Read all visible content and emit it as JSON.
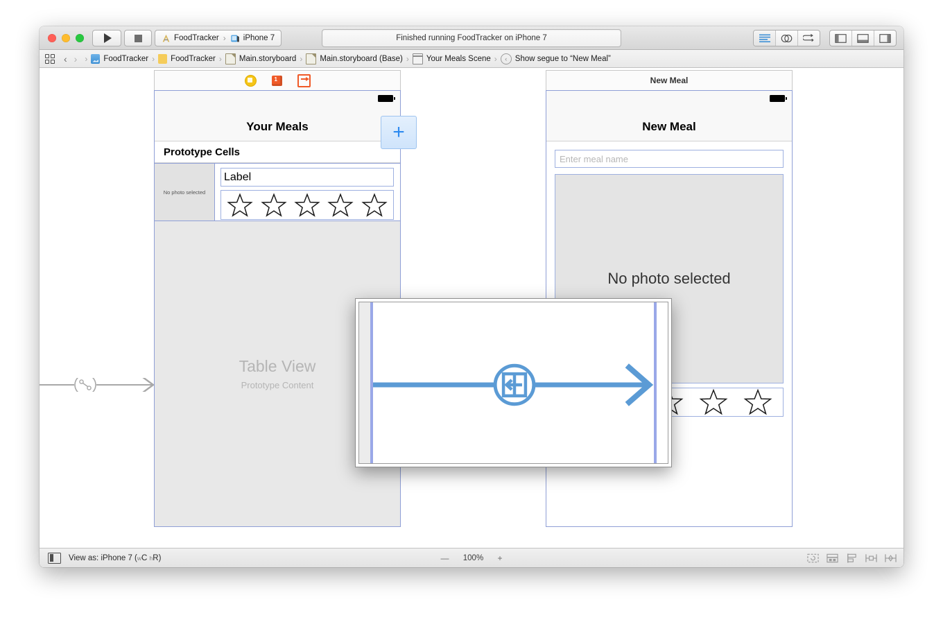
{
  "window": {
    "traffic_lights": [
      "close",
      "minimize",
      "zoom"
    ],
    "run_label": "Run",
    "stop_label": "Stop",
    "scheme": {
      "project": "FoodTracker",
      "destination": "iPhone 7"
    },
    "status": "Finished running FoodTracker on iPhone 7",
    "editor_buttons": [
      "standard-editor",
      "assistant-editor",
      "version-editor"
    ],
    "view_buttons": [
      "navigator-toggle",
      "debug-toggle",
      "utilities-toggle"
    ]
  },
  "jumpbar": {
    "back_label": "‹",
    "forward_label": "›",
    "crumbs": [
      {
        "icon": "project-icon",
        "label": "FoodTracker"
      },
      {
        "icon": "folder-icon",
        "label": "FoodTracker"
      },
      {
        "icon": "storyboard-icon",
        "label": "Main.storyboard"
      },
      {
        "icon": "storyboard-icon",
        "label": "Main.storyboard (Base)"
      },
      {
        "icon": "scene-icon",
        "label": "Your Meals Scene"
      },
      {
        "icon": "segue-icon",
        "label": "Show segue to “New Meal”"
      }
    ]
  },
  "canvas": {
    "scene_meals": {
      "dock_icons": [
        "view-controller-icon",
        "first-responder-icon",
        "exit-icon"
      ],
      "nav_title": "Your Meals",
      "add_button": "+",
      "section_header": "Prototype Cells",
      "cell": {
        "photo_placeholder": "No photo selected",
        "label": "Label",
        "stars": 5
      },
      "table_title": "Table View",
      "table_subtitle": "Prototype Content"
    },
    "scene_newmeal": {
      "scene_label": "New Meal",
      "nav_title": "New Meal",
      "name_placeholder": "Enter meal name",
      "photo_placeholder": "No photo selected",
      "stars": 5
    },
    "segue_incoming": {
      "type": "relationship-segue"
    },
    "magnifier": {
      "badge": "show-segue-icon",
      "arrow": "segue-arrow"
    }
  },
  "bottombar": {
    "view_as_prefix": "View as: ",
    "view_as_device": "iPhone 7",
    "size_class_w": "w",
    "size_class_wval": "C",
    "size_class_h": "h",
    "size_class_hval": "R",
    "zoom_out": "—",
    "zoom_level": "100%",
    "zoom_in": "+",
    "tools": [
      "update-frames-icon",
      "embed-in-icon",
      "align-icon",
      "pin-icon",
      "resolve-issues-icon"
    ]
  },
  "colors": {
    "accent_blue": "#5b9bd5",
    "device_border": "#8f9fd6",
    "orange": "#f05a28",
    "yellow": "#f5c518"
  }
}
